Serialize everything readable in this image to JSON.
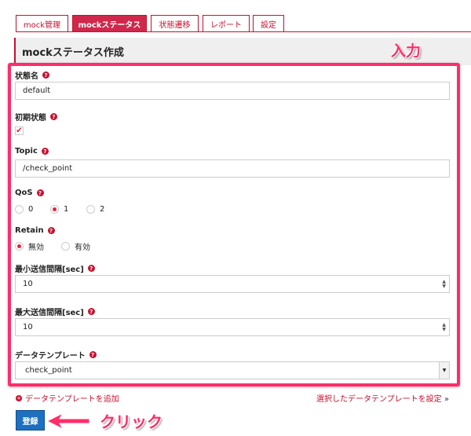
{
  "tabs": [
    {
      "label": "mock管理"
    },
    {
      "label": "mockステータス"
    },
    {
      "label": "状態遷移"
    },
    {
      "label": "レポート"
    },
    {
      "label": "設定"
    }
  ],
  "header": {
    "title": "mockステータス作成"
  },
  "annotations": {
    "input": "入力",
    "click": "クリック"
  },
  "form": {
    "state_name": {
      "label": "状態名",
      "value": "default"
    },
    "initial": {
      "label": "初期状態",
      "checked": true
    },
    "topic": {
      "label": "Topic",
      "value": "/check_point"
    },
    "qos": {
      "label": "QoS",
      "options": [
        "0",
        "1",
        "2"
      ],
      "selected": "1"
    },
    "retain": {
      "label": "Retain",
      "options": [
        "無効",
        "有効"
      ],
      "selected": "無効"
    },
    "min_interval": {
      "label": "最小送信間隔[sec]",
      "value": "10"
    },
    "max_interval": {
      "label": "最大送信間隔[sec]",
      "value": "10"
    },
    "template": {
      "label": "データテンプレート",
      "value": "check_point"
    }
  },
  "links": {
    "add": "データテンプレートを追加",
    "apply": "選択したデータテンプレートを設定",
    "apply_suffix": "»"
  },
  "submit": "登録",
  "help_glyph": "?"
}
